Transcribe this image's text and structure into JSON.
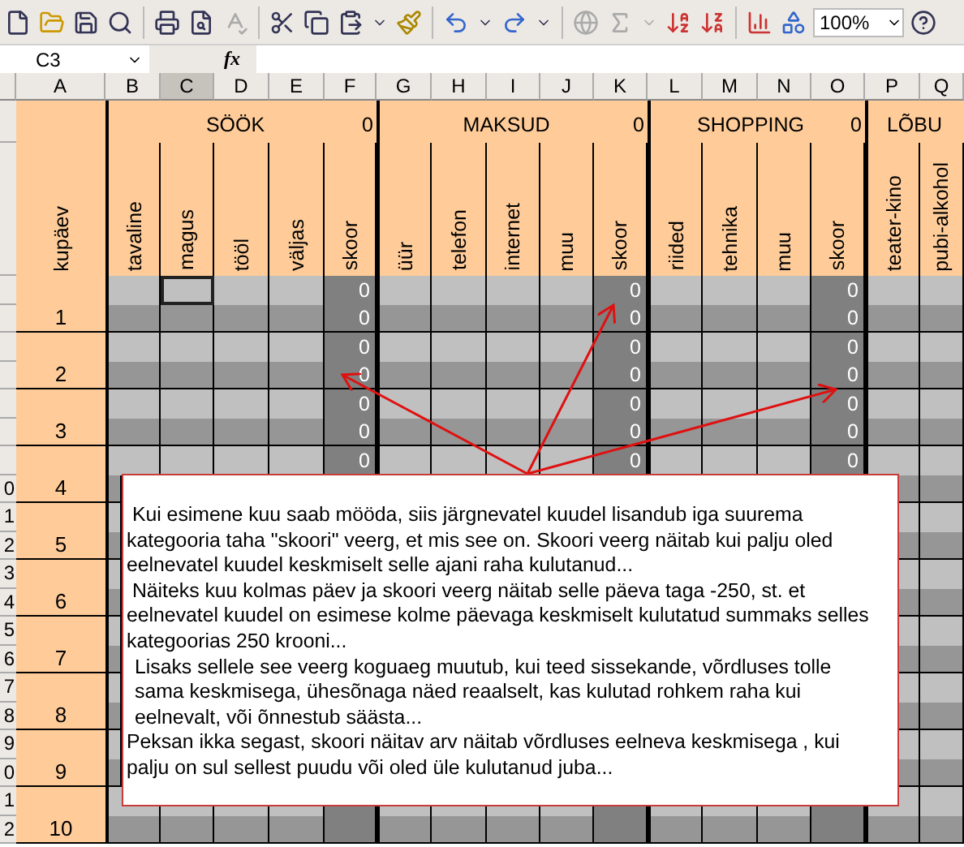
{
  "toolbar": {
    "zoom": "100%"
  },
  "formula_bar": {
    "cell_ref": "C3",
    "function_label": "fx"
  },
  "column_letters": [
    {
      "letter": "A",
      "selected": false
    },
    {
      "letter": "B",
      "selected": false
    },
    {
      "letter": "C",
      "selected": true
    },
    {
      "letter": "D",
      "selected": false
    },
    {
      "letter": "E",
      "selected": false
    },
    {
      "letter": "F",
      "selected": false
    },
    {
      "letter": "G",
      "selected": false
    },
    {
      "letter": "H",
      "selected": false
    },
    {
      "letter": "I",
      "selected": false
    },
    {
      "letter": "J",
      "selected": false
    },
    {
      "letter": "K",
      "selected": false
    },
    {
      "letter": "L",
      "selected": false
    },
    {
      "letter": "M",
      "selected": false
    },
    {
      "letter": "N",
      "selected": false
    },
    {
      "letter": "O",
      "selected": false
    },
    {
      "letter": "P",
      "selected": false
    },
    {
      "letter": "Q",
      "selected": false
    }
  ],
  "date_header": "kupäev",
  "groups": [
    {
      "title": "SÖÖK",
      "score": "0",
      "columns": [
        {
          "label": "tavaline",
          "kind": "input"
        },
        {
          "label": "magus",
          "kind": "input"
        },
        {
          "label": "tööl",
          "kind": "input"
        },
        {
          "label": "väljas",
          "kind": "input"
        },
        {
          "label": "skoor",
          "kind": "score",
          "values": [
            "0",
            "0",
            "0",
            "0",
            "0",
            "0",
            "0"
          ]
        }
      ]
    },
    {
      "title": "MAKSUD",
      "score": "0",
      "columns": [
        {
          "label": "üür",
          "kind": "input"
        },
        {
          "label": "telefon",
          "kind": "input"
        },
        {
          "label": "internet",
          "kind": "input"
        },
        {
          "label": "muu",
          "kind": "input"
        },
        {
          "label": "skoor",
          "kind": "score",
          "values": [
            "0",
            "0",
            "0",
            "0",
            "0",
            "0",
            "0"
          ]
        }
      ]
    },
    {
      "title": "SHOPPING",
      "score": "0",
      "columns": [
        {
          "label": "riided",
          "kind": "input"
        },
        {
          "label": "tehnika",
          "kind": "input"
        },
        {
          "label": "muu",
          "kind": "input"
        },
        {
          "label": "skoor",
          "kind": "score",
          "values": [
            "0",
            "0",
            "0",
            "0",
            "0",
            "0",
            "0"
          ]
        }
      ]
    },
    {
      "title": "LÕBU",
      "columns": [
        {
          "label": "teater-kino",
          "kind": "input"
        },
        {
          "label": "pubi-alkohol",
          "kind": "input"
        }
      ]
    }
  ],
  "days": [
    "1",
    "2",
    "3",
    "4",
    "5",
    "6",
    "7",
    "8",
    "9",
    "10"
  ],
  "row_header_digits": [
    "0",
    "1",
    "2",
    "3",
    "4",
    "5",
    "6",
    "7",
    "8",
    "9",
    "0",
    "1",
    "2"
  ],
  "note": {
    "paragraphs": [
      {
        "text": " Kui esimene kuu saab mööda, siis järgnevatel kuudel lisandub iga suurema kategooria taha \"skoori\" veerg, et mis see on. Skoori veerg näitab kui palju oled eelnevatel kuudel keskmiselt selle ajani raha kulutanud...",
        "indented": false
      },
      {
        "text": " Näiteks kuu kolmas päev ja skoori veerg näitab selle päeva taga -250, st. et eelnevatel kuudel on esimese kolme päevaga keskmiselt kulutatud summaks selles kategoorias 250 krooni...",
        "indented": false
      },
      {
        "text": "Lisaks sellele see veerg koguaeg muutub, kui teed sissekande, võrdluses tolle sama keskmisega, ühesõnaga näed reaalselt, kas kulutad rohkem raha kui eelnevalt, või õnnestub säästa...",
        "indented": true
      },
      {
        "text": "Peksan ikka segast, skoori näitav arv näitab võrdluses eelneva keskmisega , kui palju on sul sellest puudu või oled üle kulutanud juba...",
        "indented": false
      }
    ]
  }
}
